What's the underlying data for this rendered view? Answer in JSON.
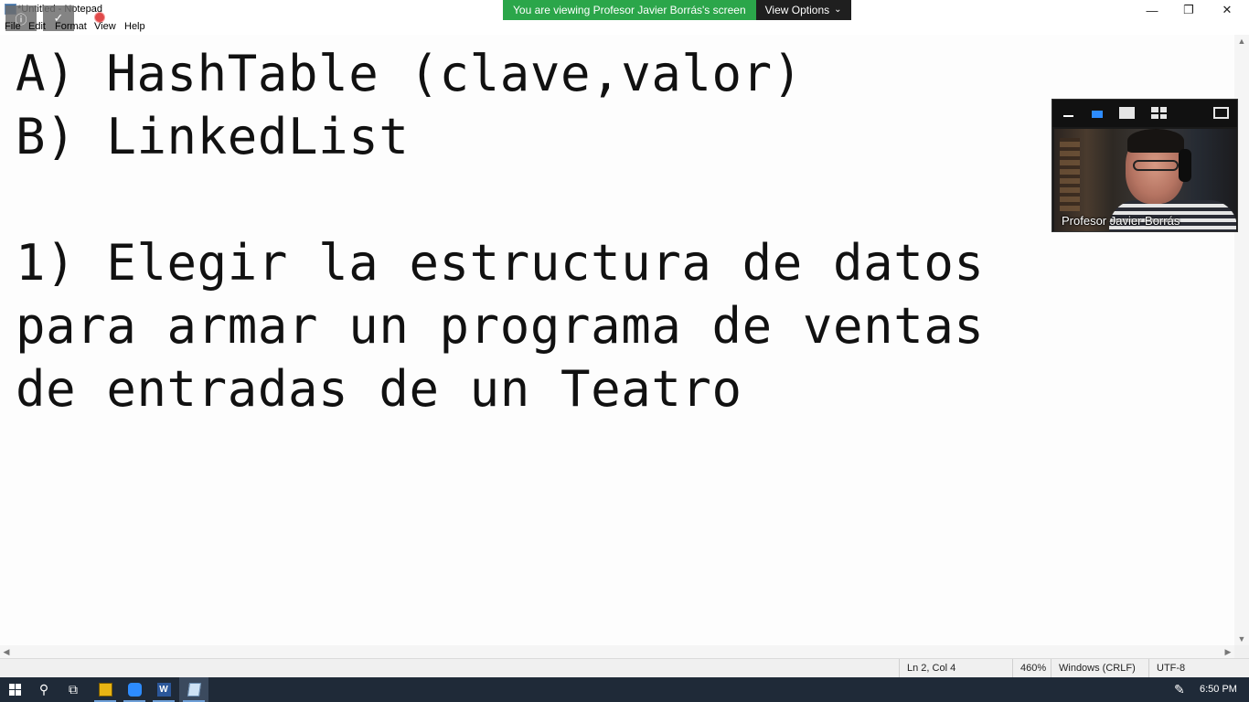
{
  "window": {
    "title": "*Untitled - Notepad",
    "controls": {
      "minimize": "—",
      "maximize": "❐",
      "close": "✕"
    }
  },
  "zoom": {
    "share_banner": "You are viewing Profesor Javier Borrás's screen",
    "view_options": "View Options",
    "participant_name": "Profesor Javier Borrás"
  },
  "menu": {
    "items": [
      "File",
      "Edit",
      "Format",
      "View",
      "Help"
    ]
  },
  "editor": {
    "content": "A) HashTable (clave,valor)\nB) LinkedList\n\n1) Elegir la estructura de datos\npara armar un programa de ventas\nde entradas de un Teatro"
  },
  "status": {
    "position": "Ln 2, Col 4",
    "zoom": "460%",
    "line_ending": "Windows (CRLF)",
    "encoding": "UTF-8"
  },
  "taskbar": {
    "time": "6:50 PM",
    "icons": [
      "start-icon",
      "search-icon",
      "task-view-icon",
      "app-icon",
      "zoom-icon",
      "word-icon",
      "notepad-icon"
    ]
  },
  "colors": {
    "share_banner_bg": "#2ba64a",
    "taskbar_bg": "#1f2a38",
    "speaker_view_accent": "#2d8cff"
  }
}
